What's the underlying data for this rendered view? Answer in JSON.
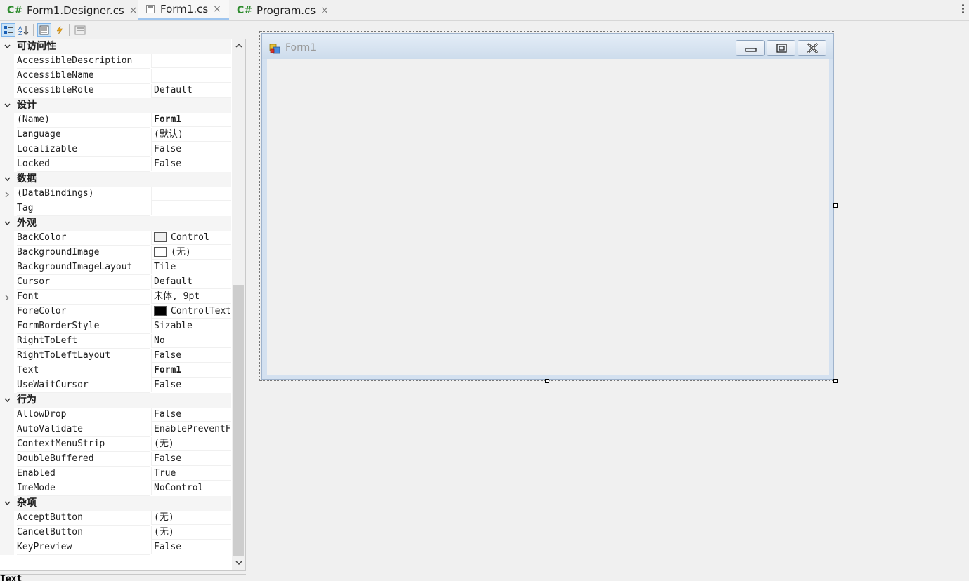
{
  "tabs": [
    {
      "label": "Form1.Designer.cs",
      "prefix": "C#",
      "active": false
    },
    {
      "label": "Form1.cs",
      "prefix": "",
      "active": true
    },
    {
      "label": "Program.cs",
      "prefix": "C#",
      "active": false
    }
  ],
  "tab_close_glyph": "×",
  "properties": {
    "rows": [
      {
        "kind": "cat",
        "label": "可访问性"
      },
      {
        "kind": "prop",
        "name": "AccessibleDescription",
        "value": ""
      },
      {
        "kind": "prop",
        "name": "AccessibleName",
        "value": ""
      },
      {
        "kind": "prop",
        "name": "AccessibleRole",
        "value": "Default"
      },
      {
        "kind": "cat",
        "label": "设计"
      },
      {
        "kind": "prop",
        "name": "(Name)",
        "value": "Form1",
        "bold": true
      },
      {
        "kind": "prop",
        "name": "Language",
        "value": "(默认)"
      },
      {
        "kind": "prop",
        "name": "Localizable",
        "value": "False"
      },
      {
        "kind": "prop",
        "name": "Locked",
        "value": "False"
      },
      {
        "kind": "cat",
        "label": "数据"
      },
      {
        "kind": "prop",
        "name": "(DataBindings)",
        "value": "",
        "expand": true
      },
      {
        "kind": "prop",
        "name": "Tag",
        "value": ""
      },
      {
        "kind": "cat",
        "label": "外观"
      },
      {
        "kind": "prop",
        "name": "BackColor",
        "value": "Control",
        "swatch": "#f0f0f0"
      },
      {
        "kind": "prop",
        "name": "BackgroundImage",
        "value": "(无)",
        "swatch": "#ffffff"
      },
      {
        "kind": "prop",
        "name": "BackgroundImageLayout",
        "value": "Tile"
      },
      {
        "kind": "prop",
        "name": "Cursor",
        "value": "Default"
      },
      {
        "kind": "prop",
        "name": "Font",
        "value": "宋体, 9pt",
        "expand": true
      },
      {
        "kind": "prop",
        "name": "ForeColor",
        "value": "ControlText",
        "swatch": "#000000"
      },
      {
        "kind": "prop",
        "name": "FormBorderStyle",
        "value": "Sizable"
      },
      {
        "kind": "prop",
        "name": "RightToLeft",
        "value": "No"
      },
      {
        "kind": "prop",
        "name": "RightToLeftLayout",
        "value": "False"
      },
      {
        "kind": "prop",
        "name": "Text",
        "value": "Form1",
        "bold": true
      },
      {
        "kind": "prop",
        "name": "UseWaitCursor",
        "value": "False"
      },
      {
        "kind": "cat",
        "label": "行为"
      },
      {
        "kind": "prop",
        "name": "AllowDrop",
        "value": "False"
      },
      {
        "kind": "prop",
        "name": "AutoValidate",
        "value": "EnablePreventFocusChange"
      },
      {
        "kind": "prop",
        "name": "ContextMenuStrip",
        "value": "(无)"
      },
      {
        "kind": "prop",
        "name": "DoubleBuffered",
        "value": "False"
      },
      {
        "kind": "prop",
        "name": "Enabled",
        "value": "True"
      },
      {
        "kind": "prop",
        "name": "ImeMode",
        "value": "NoControl"
      },
      {
        "kind": "cat",
        "label": "杂项"
      },
      {
        "kind": "prop",
        "name": "AcceptButton",
        "value": "(无)"
      },
      {
        "kind": "prop",
        "name": "CancelButton",
        "value": "(无)"
      },
      {
        "kind": "prop",
        "name": "KeyPreview",
        "value": "False"
      }
    ]
  },
  "description_title": "Text",
  "form": {
    "title": "Form1"
  }
}
